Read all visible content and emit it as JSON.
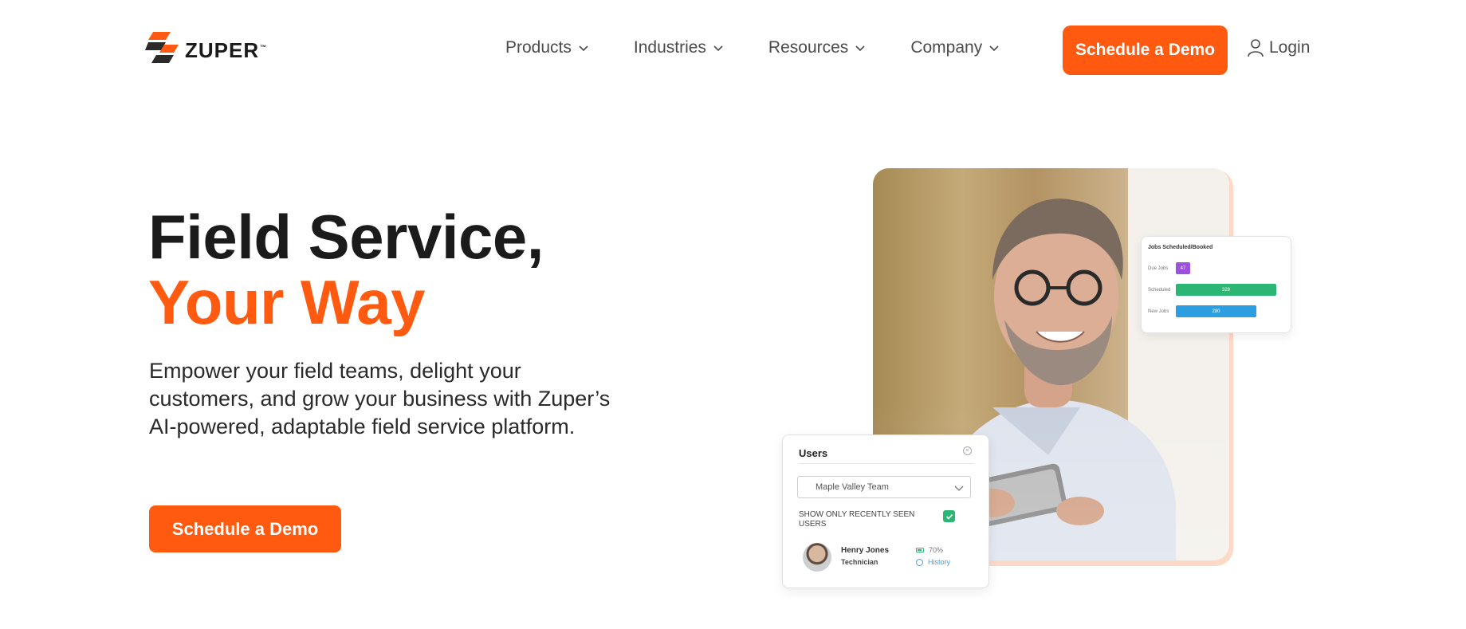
{
  "brand": {
    "name": "ZUPER",
    "tm": "™",
    "accent_color": "#ff5a0f"
  },
  "nav": {
    "items": [
      {
        "label": "Products"
      },
      {
        "label": "Industries"
      },
      {
        "label": "Resources"
      },
      {
        "label": "Company"
      }
    ],
    "demo_button": "Schedule a Demo",
    "login_label": "Login"
  },
  "hero": {
    "title_line1": "Field Service,",
    "title_line2": "Your Way",
    "subtitle": "Empower your field teams, delight your customers, and grow your business with Zuper’s AI-powered, adaptable field service platform.",
    "cta": "Schedule a Demo"
  },
  "jobs_card": {
    "title": "Jobs Scheduled/Booked",
    "rows": [
      {
        "label": "Due Jobs",
        "value": "47",
        "color": "#9b51e0"
      },
      {
        "label": "Scheduled",
        "value": "328",
        "color": "#2bb673"
      },
      {
        "label": "New Jobs",
        "value": "280",
        "color": "#2d9ee0"
      }
    ]
  },
  "users_card": {
    "title": "Users",
    "select_value": "Maple Valley Team",
    "checkbox_label": "SHOW ONLY RECENTLY SEEN USERS",
    "user": {
      "name": "Henry Jones",
      "role": "Technician",
      "battery": "70%",
      "history": "History"
    }
  }
}
